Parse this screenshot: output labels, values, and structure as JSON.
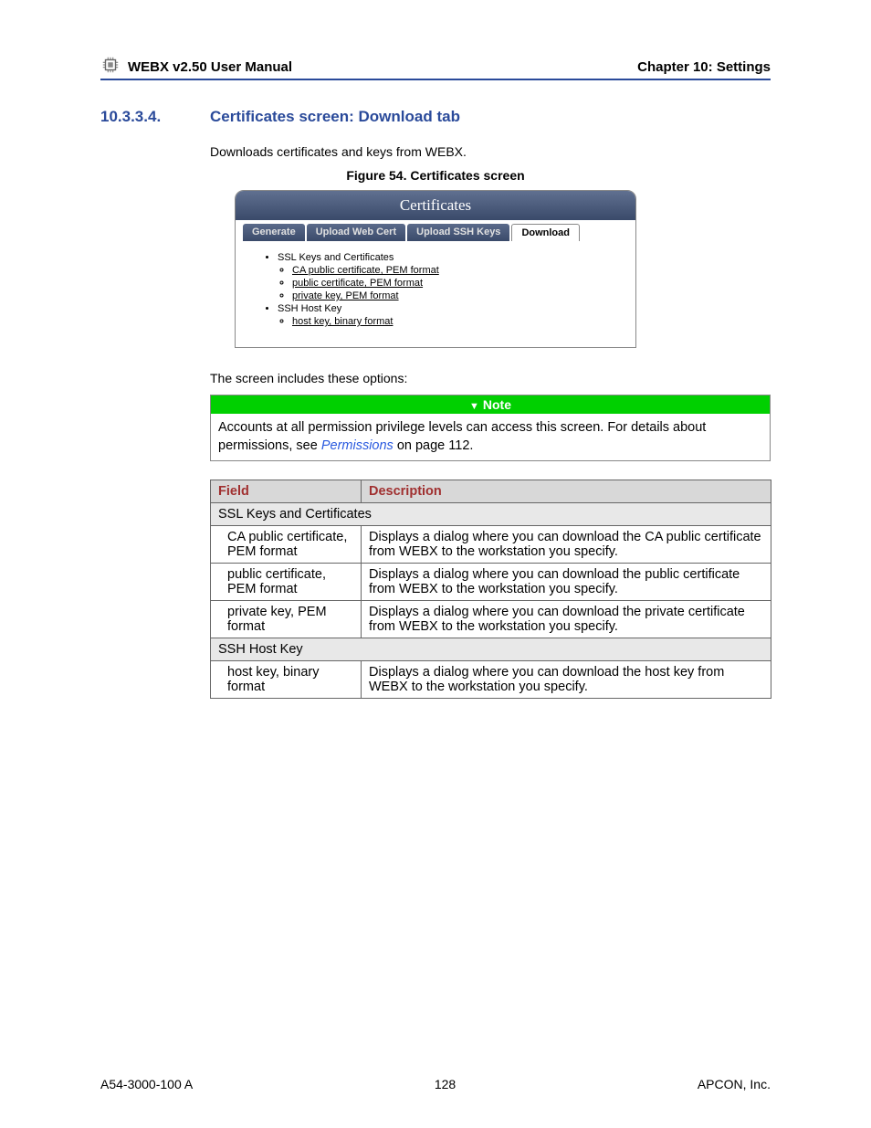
{
  "header": {
    "product": "WEBX",
    "manual_title": "v2.50 User Manual",
    "chapter": "Chapter 10: Settings"
  },
  "section": {
    "number": "10.3.3.4.",
    "title": "Certificates screen: Download tab",
    "intro_prefix": "Downloads certificates  and keys from ",
    "intro_app": "WEBX",
    "intro_suffix": "."
  },
  "figure": {
    "caption": "Figure 54. Certificates screen",
    "title": "Certificates",
    "tabs": [
      "Generate",
      "Upload Web Cert",
      "Upload SSH Keys",
      "Download"
    ],
    "bullets": {
      "group1_label": "SSL Keys and Certificates",
      "group1_items": [
        "CA public certificate, PEM format",
        "public certificate, PEM format",
        "private key, PEM format"
      ],
      "group2_label": "SSH Host Key",
      "group2_items": [
        "host key, binary format"
      ]
    }
  },
  "options_intro": "The screen includes these options:",
  "note": {
    "label": "Note",
    "text_before": "Accounts at all permission privilege levels can access this screen. For details about permissions, see ",
    "link_text": "Permissions",
    "text_after": " on page 112."
  },
  "table": {
    "col1": "Field",
    "col2": "Description",
    "section1": "SSL Keys and Certificates",
    "rows1": [
      {
        "field": "CA public certificate, PEM format",
        "desc_before": "Displays a dialog where you can download the CA public certificate from ",
        "app": "WEBX",
        "desc_after": " to the workstation you specify."
      },
      {
        "field": "public certificate, PEM format",
        "desc_before": "Displays a dialog where you can download the public certificate from ",
        "app": "WEBX",
        "desc_after": " to the workstation you specify."
      },
      {
        "field": "private key, PEM format",
        "desc_before": "Displays a dialog where you can download the private certificate from ",
        "app": "WEBX",
        "desc_after": " to the workstation you specify."
      }
    ],
    "section2": "SSH Host Key",
    "rows2": [
      {
        "field": "host key, binary format",
        "desc_before": "Displays a dialog where you can download the host key from ",
        "app": "WEBX",
        "desc_after": " to the workstation you specify."
      }
    ]
  },
  "footer": {
    "doc_number": "A54-3000-100 A",
    "page": "128",
    "company_caps": "APCON",
    "company_suffix": ", Inc."
  }
}
